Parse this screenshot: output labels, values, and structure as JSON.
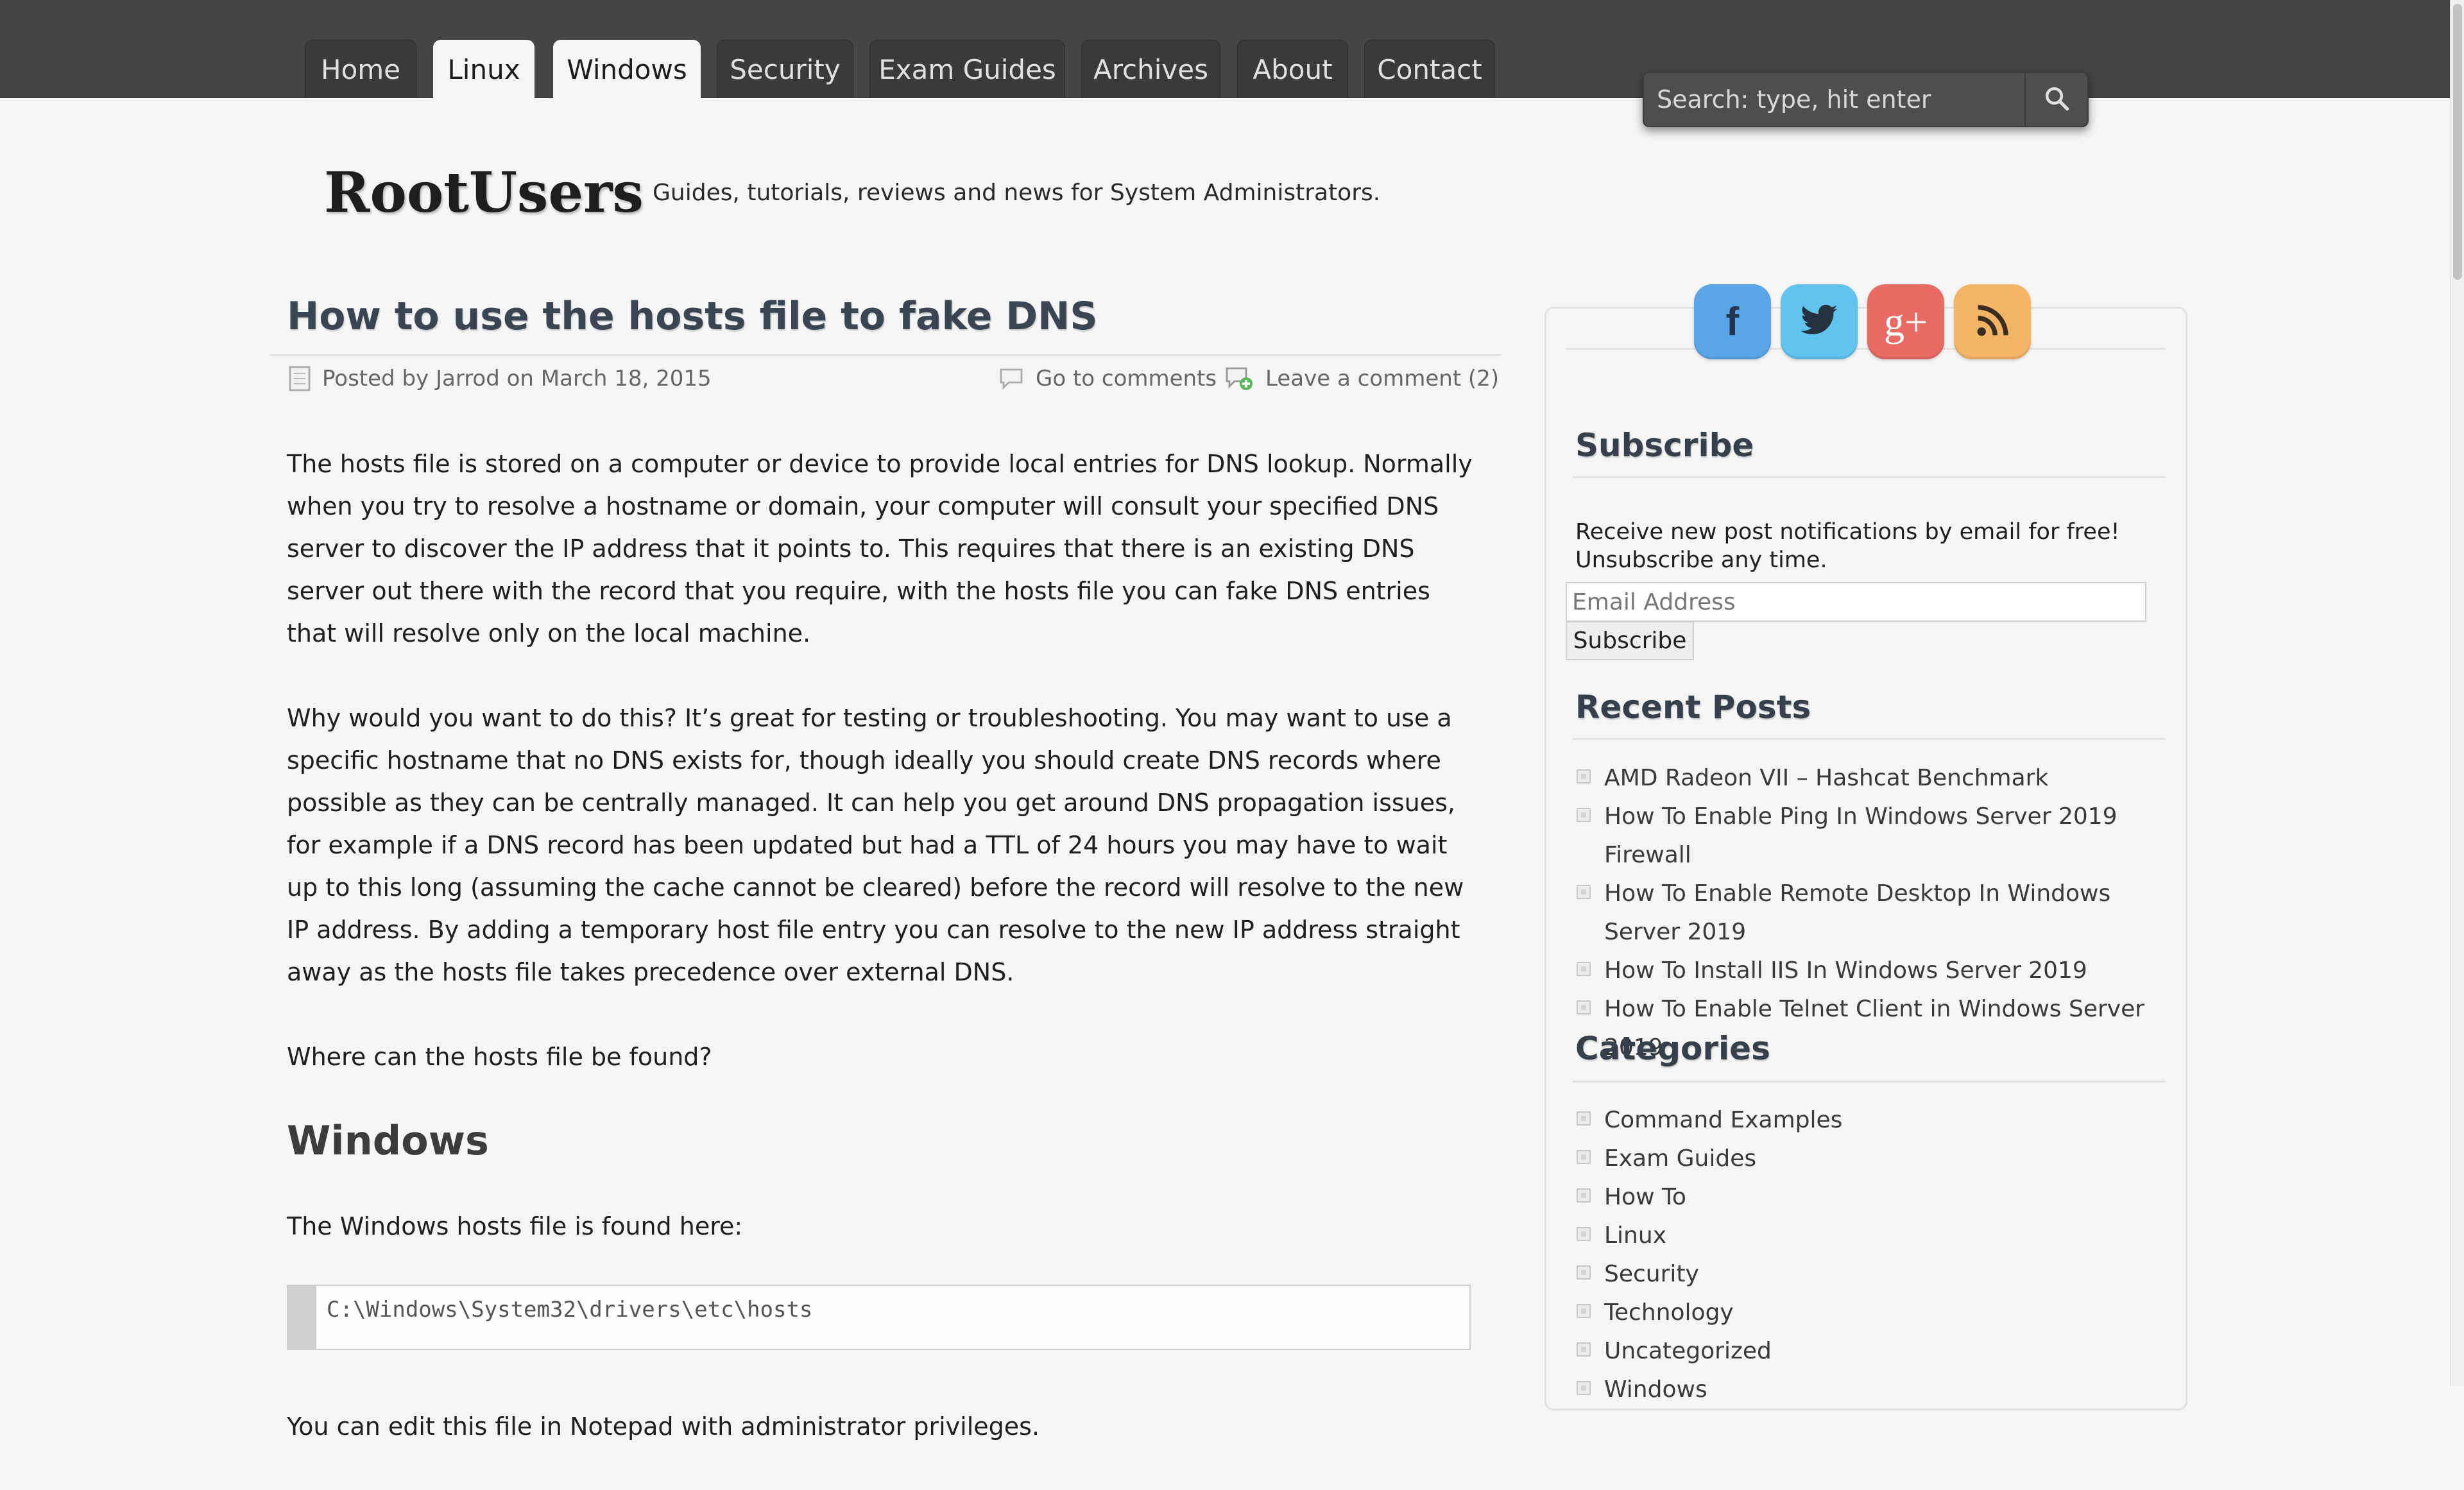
{
  "nav": {
    "tabs": [
      {
        "label": "Home",
        "active": false
      },
      {
        "label": "Linux",
        "active": true
      },
      {
        "label": "Windows",
        "active": true
      },
      {
        "label": "Security",
        "active": false
      },
      {
        "label": "Exam Guides",
        "active": false
      },
      {
        "label": "Archives",
        "active": false
      },
      {
        "label": "About",
        "active": false
      },
      {
        "label": "Contact",
        "active": false
      }
    ]
  },
  "search": {
    "placeholder": "Search: type, hit enter",
    "icon": "search-icon"
  },
  "site": {
    "title": "RootUsers",
    "tagline": "Guides, tutorials, reviews and news for System Administrators."
  },
  "post": {
    "title": "How to use the hosts file to fake DNS",
    "meta": {
      "posted": "Posted by Jarrod on March 18, 2015",
      "go_to_comments": "Go to comments",
      "leave_comment": "Leave a comment (2)"
    },
    "paragraphs": [
      "The hosts file is stored on a computer or device to provide local entries for DNS lookup. Normally when you try to resolve a hostname or domain, your computer will consult your specified DNS server to discover the IP address that it points to. This requires that there is an existing DNS server out there with the record that you require, with the hosts file you can fake DNS entries that will resolve only on the local machine.",
      "Why would you want to do this? It’s great for testing or troubleshooting. You may want to use a specific hostname that no DNS exists for, though ideally you should create DNS records where possible as they can be centrally managed. It can help you get around DNS propagation issues, for example if a DNS record has been updated but had a TTL of 24 hours you may have to wait up to this long (assuming the cache cannot be cleared) before the record will resolve to the new IP address. By adding a temporary host file entry you can resolve to the new IP address straight away as the hosts file takes precedence over external DNS.",
      "Where can the hosts file be found?"
    ],
    "windows_heading": "Windows",
    "windows_intro": "The Windows hosts file is found here:",
    "code": "C:\\Windows\\System32\\drivers\\etc\\hosts",
    "after_code": "You can edit this file in Notepad with administrator privileges."
  },
  "sidebar": {
    "social": [
      {
        "name": "facebook",
        "glyph": "f",
        "color": "#5aa5e6"
      },
      {
        "name": "twitter",
        "color": "#63c3ef"
      },
      {
        "name": "google-plus",
        "glyph": "g+",
        "color": "#ea6a64"
      },
      {
        "name": "rss",
        "color": "#f3b466"
      }
    ],
    "subscribe": {
      "title": "Subscribe",
      "text": "Receive new post notifications by email for free! Unsubscribe any time.",
      "email_placeholder": "Email Address",
      "button": "Subscribe"
    },
    "recent_posts": {
      "title": "Recent Posts",
      "items": [
        "AMD Radeon VII – Hashcat Benchmark",
        "How To Enable Ping In Windows Server 2019 Firewall",
        "How To Enable Remote Desktop In Windows Server 2019",
        "How To Install IIS In Windows Server 2019",
        "How To Enable Telnet Client in Windows Server 2019"
      ]
    },
    "categories": {
      "title": "Categories",
      "items": [
        "Command Examples",
        "Exam Guides",
        "How To",
        "Linux",
        "Security",
        "Technology",
        "Uncategorized",
        "Windows"
      ]
    }
  }
}
